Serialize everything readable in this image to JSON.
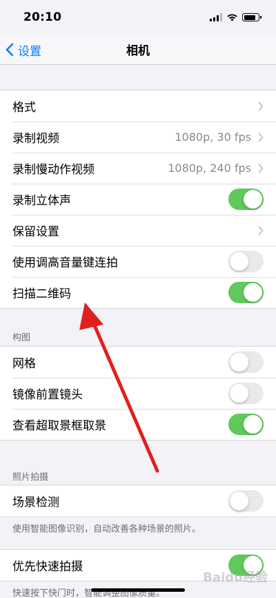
{
  "status_bar": {
    "time": "20:10"
  },
  "nav": {
    "back_label": "设置",
    "title": "相机"
  },
  "group1": [
    {
      "label": "格式",
      "value": "",
      "control": "chevron"
    },
    {
      "label": "录制视频",
      "value": "1080p, 30 fps",
      "control": "chevron"
    },
    {
      "label": "录制慢动作视频",
      "value": "1080p, 240 fps",
      "control": "chevron"
    },
    {
      "label": "录制立体声",
      "control": "toggle",
      "on": true
    },
    {
      "label": "保留设置",
      "value": "",
      "control": "chevron"
    },
    {
      "label": "使用调高音量键连拍",
      "control": "toggle",
      "on": false
    },
    {
      "label": "扫描二维码",
      "control": "toggle",
      "on": true
    }
  ],
  "composition": {
    "header": "构图",
    "rows": [
      {
        "label": "网格",
        "control": "toggle",
        "on": false
      },
      {
        "label": "镜像前置镜头",
        "control": "toggle",
        "on": false
      },
      {
        "label": "查看超取景框取景",
        "control": "toggle",
        "on": true
      }
    ]
  },
  "photo_capture": {
    "header": "照片拍摄",
    "rows": [
      {
        "label": "场景检测",
        "control": "toggle",
        "on": false
      }
    ],
    "footer": "使用智能图像识别，自动改善各种场景的照片。"
  },
  "fast_capture": {
    "rows": [
      {
        "label": "优先快速拍摄",
        "control": "toggle",
        "on": true
      }
    ],
    "footer": "快速按下快门时，智能调整图像质量。"
  },
  "watermark": "Baidu经验",
  "colors": {
    "accent": "#0a7aff",
    "toggle_on": "#5fc95c",
    "annotation_arrow": "#e0201f"
  }
}
